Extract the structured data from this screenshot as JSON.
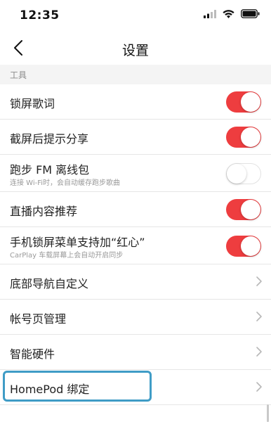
{
  "status_bar": {
    "time": "12:35",
    "icons": [
      "signal-icon",
      "wifi-icon",
      "battery-icon"
    ]
  },
  "nav": {
    "title": "设置",
    "back_icon": "back-chevron-icon"
  },
  "section": {
    "title": "工具"
  },
  "rows": [
    {
      "label": "锁屏歌词",
      "sub": null,
      "control": "toggle",
      "on": true
    },
    {
      "label": "截屏后提示分享",
      "sub": null,
      "control": "toggle",
      "on": true
    },
    {
      "label": "跑步 FM 离线包",
      "sub": "连接 Wi-Fi时，会自动缓存跑步歌曲",
      "control": "toggle",
      "on": false
    },
    {
      "label": "直播内容推荐",
      "sub": null,
      "control": "toggle",
      "on": true
    },
    {
      "label": "手机锁屏菜单支持加“红心”",
      "sub": "CarPlay 车载屏幕上会自动开启同步",
      "control": "toggle",
      "on": true
    },
    {
      "label": "底部导航自定义",
      "sub": null,
      "control": "chevron"
    },
    {
      "label": "帐号页管理",
      "sub": null,
      "control": "chevron"
    },
    {
      "label": "智能硬件",
      "sub": null,
      "control": "chevron"
    },
    {
      "label": "HomePod 绑定",
      "sub": null,
      "control": "chevron"
    }
  ],
  "colors": {
    "accent": "#ee3d3f",
    "highlight_border": "#3f9cc6",
    "section_bg": "#f4f4f4"
  }
}
